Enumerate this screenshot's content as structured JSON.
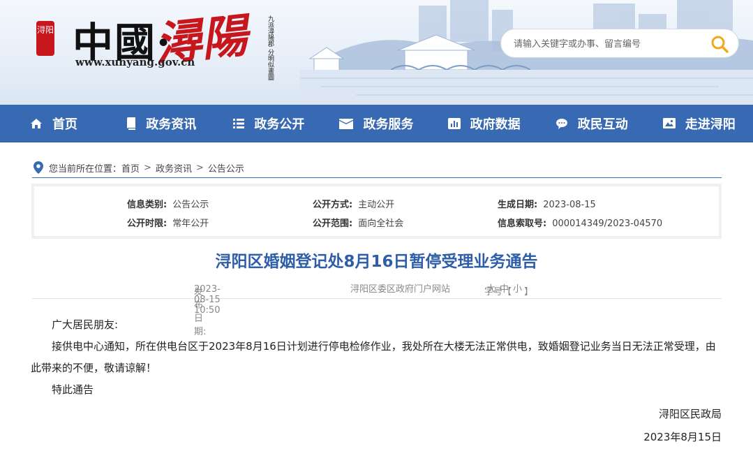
{
  "header": {
    "seal_text": "浔阳",
    "logo_main": "中國·",
    "logo_cursive": "潯陽",
    "site_url": "www.xunyang.gov.cn",
    "poem": "九派潯陽郡 分明似畫圖",
    "search_placeholder": "请输入关键字或办事、留言编号",
    "search_icon": "search-icon",
    "search_color": "#f0a81c"
  },
  "nav": {
    "color": "#3869b3",
    "items": [
      {
        "label": "首页",
        "icon": "home-icon"
      },
      {
        "label": "政务资讯",
        "icon": "book-icon"
      },
      {
        "label": "政务公开",
        "icon": "list-icon"
      },
      {
        "label": "政务服务",
        "icon": "envelope-icon"
      },
      {
        "label": "政府数据",
        "icon": "bar-chart-icon"
      },
      {
        "label": "政民互动",
        "icon": "chat-icon"
      },
      {
        "label": "走进浔阳",
        "icon": "image-icon"
      }
    ]
  },
  "breadcrumb": {
    "prefix": "您当前所在位置：",
    "items": [
      "首页",
      "政务资讯",
      "公告公示"
    ],
    "separator": ">"
  },
  "info": {
    "category_label": "信息类别:",
    "category_value": "公告公示",
    "method_label": "公开方式:",
    "method_value": "主动公开",
    "date_label": "生成日期:",
    "date_value": "2023-08-15",
    "term_label": "公开时限:",
    "term_value": "常年公开",
    "scope_label": "公开范围:",
    "scope_value": "面向全社会",
    "index_label": "信息索取号:",
    "index_value": "000014349/2023-04570"
  },
  "article": {
    "title": "浔阳区婚姻登记处8月16日暂停受理业务通告",
    "publish_label": "发布日期:",
    "publish_value": "2023-08-15 10:50",
    "source": "浔阳区委区政府门户网站",
    "font_label": "字号【",
    "font_large": "大",
    "font_medium": "中",
    "font_small": "小",
    "font_end": "】",
    "greeting": "广大居民朋友:",
    "body": "接供电中心通知，所在供电台区于2023年8月16日计划进行停电检修作业，我处所在大楼无法正常供电，致婚姻登记业务当日无法正常受理，由此带来的不便，敬请谅解！",
    "closing": "特此通告",
    "signature": "浔阳区民政局",
    "date": "2023年8月15日"
  }
}
